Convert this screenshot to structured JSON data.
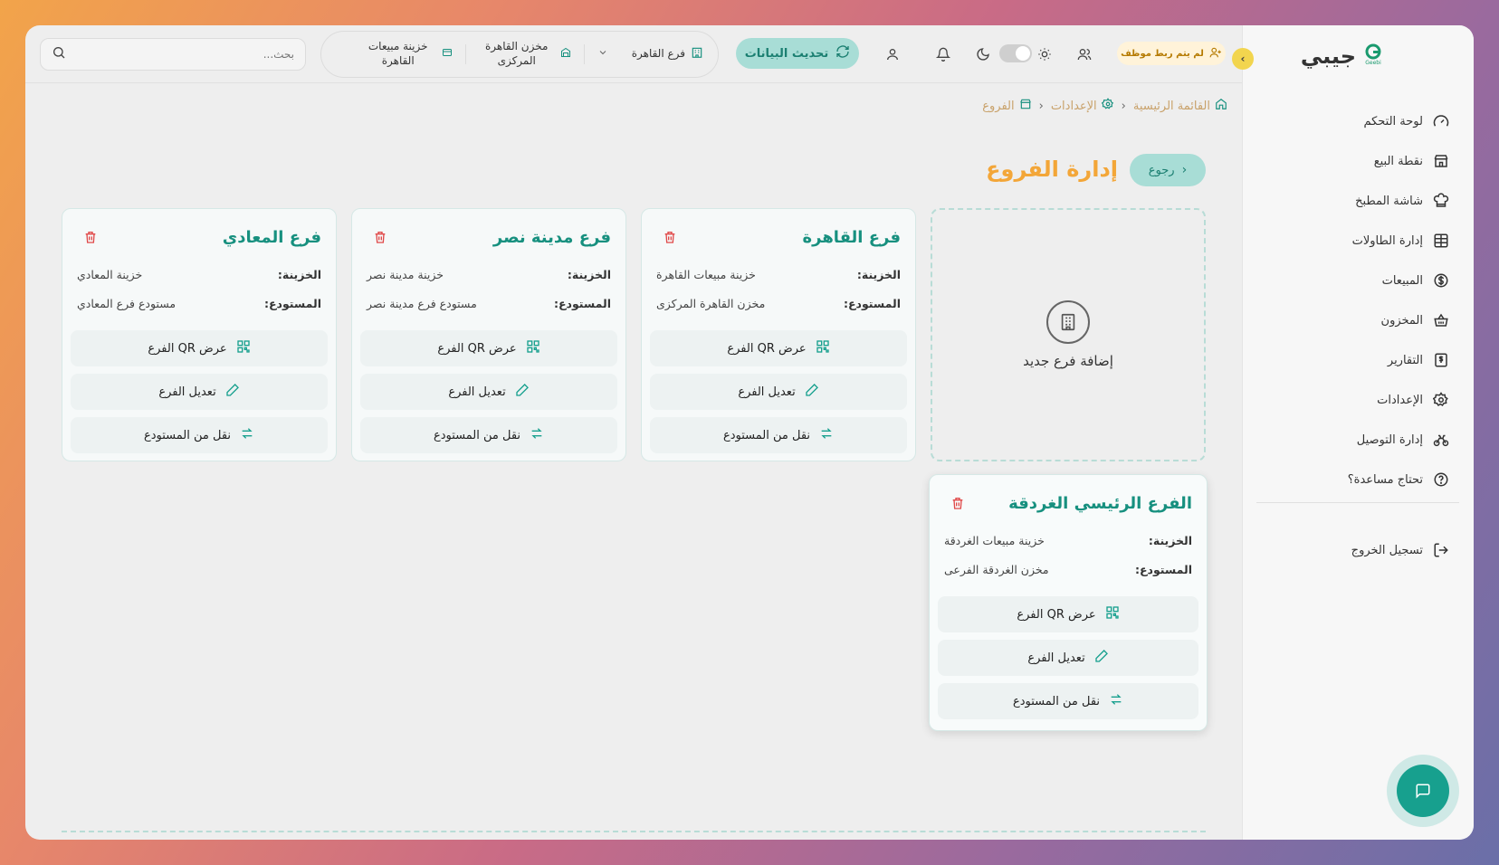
{
  "app": {
    "name": "جيبي",
    "logo_sub": "Geebi"
  },
  "header": {
    "search_placeholder": "بحث...",
    "context": [
      {
        "label": "فرع القاهرة",
        "icon": "building-icon"
      },
      {
        "label": "مخزن القاهرة المركزى",
        "icon": "warehouse-icon"
      },
      {
        "label": "خزينة مبيعات القاهرة",
        "icon": "cashbox-icon"
      }
    ],
    "refresh_label": "تحديث البيانات",
    "staff_badge": "لم يتم ربط موظف"
  },
  "sidebar": {
    "items": [
      {
        "label": "لوحة التحكم",
        "icon": "gauge-icon"
      },
      {
        "label": "نقطة البيع",
        "icon": "store-icon"
      },
      {
        "label": "شاشة المطبخ",
        "icon": "chef-hat-icon"
      },
      {
        "label": "إدارة الطاولات",
        "icon": "table-grid-icon"
      },
      {
        "label": "المبيعات",
        "icon": "dollar-circle-icon"
      },
      {
        "label": "المخزون",
        "icon": "basket-icon"
      },
      {
        "label": "التقارير",
        "icon": "report-dollar-icon"
      },
      {
        "label": "الإعدادات",
        "icon": "gear-icon"
      },
      {
        "label": "إدارة التوصيل",
        "icon": "bike-icon"
      },
      {
        "label": "تحتاج مساعدة؟",
        "icon": "help-circle-icon"
      }
    ],
    "logout_label": "تسجيل الخروج"
  },
  "breadcrumb": [
    {
      "label": "القائمة الرئيسية",
      "icon": "home-icon"
    },
    {
      "label": "الإعدادات",
      "icon": "gear-icon"
    },
    {
      "label": "الفروع",
      "icon": "store-icon"
    }
  ],
  "page": {
    "title": "إدارة الفروع",
    "back_label": "رجوع",
    "add_branch_label": "إضافة فرع جديد"
  },
  "labels": {
    "treasury": "الخزينة:",
    "warehouse": "المستودع:",
    "qr": "عرض QR الفرع",
    "edit": "تعديل الفرع",
    "transfer": "نقل من المستودع"
  },
  "branches": [
    {
      "name": "فرع القاهرة",
      "treasury": "خزينة مبيعات القاهرة",
      "warehouse": "مخزن القاهرة المركزى"
    },
    {
      "name": "فرع مدينة نصر",
      "treasury": "خزينة مدينة نصر",
      "warehouse": "مستودع فرع مدينة نصر"
    },
    {
      "name": "فرع المعادي",
      "treasury": "خزينة المعادي",
      "warehouse": "مستودع فرع المعادي"
    },
    {
      "name": "الفرع الرئيسي الغردقة",
      "treasury": "خزينة مبيعات الغردقة",
      "warehouse": "مخزن الغردقة الفرعى"
    }
  ],
  "colors": {
    "accent": "#17907f",
    "title": "#f3a638",
    "danger": "#e04848"
  }
}
